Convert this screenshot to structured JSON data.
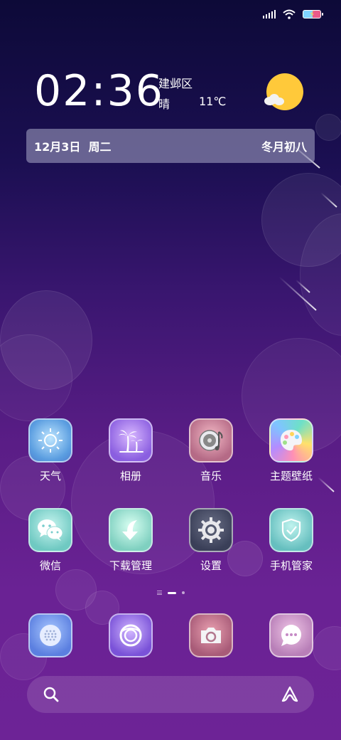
{
  "status_bar": {
    "signal_icon": "signal-icon",
    "wifi_icon": "wifi-icon",
    "battery_icon": "battery-charging-icon"
  },
  "clock": {
    "time": "02:36"
  },
  "weather": {
    "location": "建邺区",
    "condition": "晴",
    "temperature": "11℃",
    "icon": "sunny-cloud-icon"
  },
  "date_bar": {
    "date": "12月3日  周二",
    "lunar": "冬月初八"
  },
  "apps_row1": [
    {
      "label": "天气",
      "icon": "weather-sun-icon"
    },
    {
      "label": "相册",
      "icon": "palm-tree-icon"
    },
    {
      "label": "音乐",
      "icon": "music-disc-icon"
    },
    {
      "label": "主题壁纸",
      "icon": "palette-icon"
    }
  ],
  "apps_row2": [
    {
      "label": "微信",
      "icon": "wechat-icon"
    },
    {
      "label": "下载管理",
      "icon": "download-arrow-icon"
    },
    {
      "label": "设置",
      "icon": "gear-icon"
    },
    {
      "label": "手机管家",
      "icon": "shield-check-icon"
    }
  ],
  "dock": [
    {
      "icon": "dialer-icon"
    },
    {
      "icon": "browser-icon"
    },
    {
      "icon": "camera-icon"
    },
    {
      "icon": "messages-icon"
    }
  ],
  "page_indicator": {
    "pages": 3,
    "active": 2
  },
  "search": {
    "icon": "search-icon",
    "assistant_icon": "assistant-icon"
  }
}
